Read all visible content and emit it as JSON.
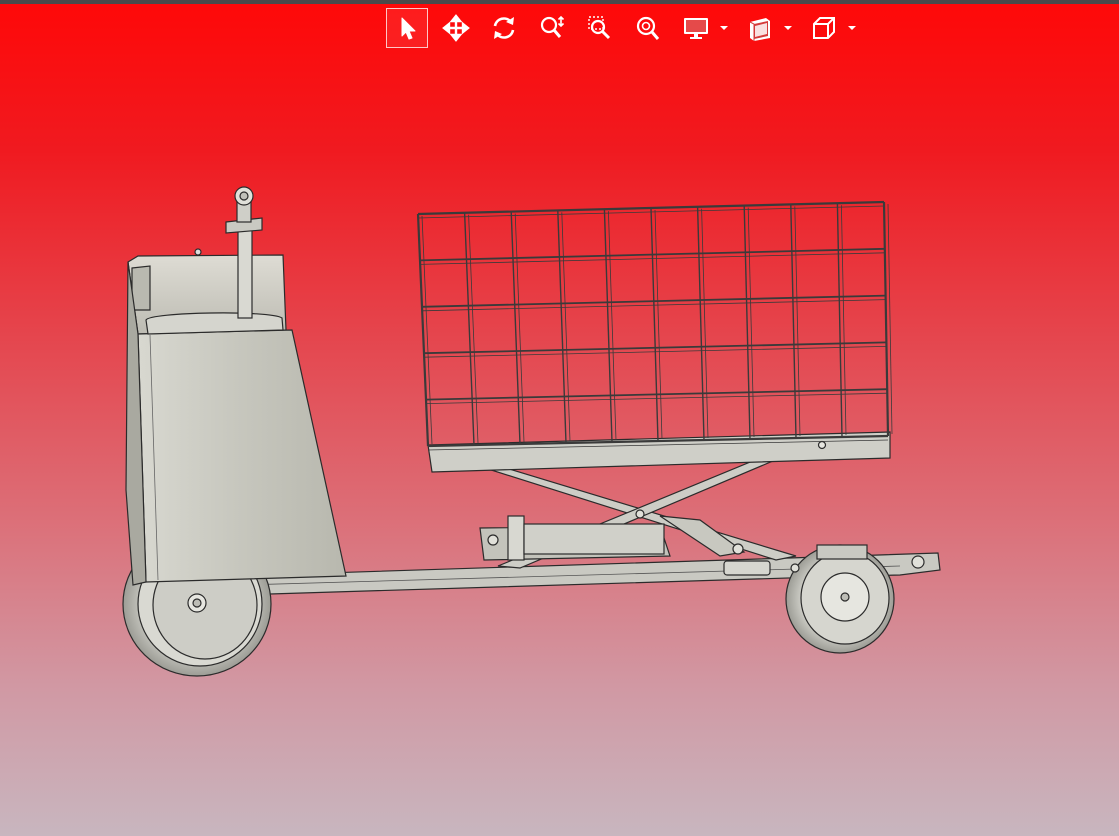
{
  "toolbar": {
    "tools": [
      {
        "icon": "select-pointer-icon",
        "active": true
      },
      {
        "icon": "pan-icon"
      },
      {
        "icon": "rotate-icon"
      },
      {
        "icon": "zoom-icon"
      },
      {
        "icon": "zoom-window-icon"
      },
      {
        "icon": "zoom-fit-icon"
      },
      {
        "icon": "display-mode-icon",
        "dropdown": true
      },
      {
        "icon": "section-view-icon",
        "dropdown": true
      },
      {
        "icon": "standard-views-cube-icon",
        "dropdown": true
      }
    ]
  },
  "viewport": {
    "background_top": "#ff0808",
    "background_bottom": "#c8b6bf",
    "model": "scissor-lift-cart"
  },
  "colors": {
    "part_fill": "#c9c9c2",
    "part_stroke": "#2b2b2b",
    "icon": "#ffffff"
  }
}
